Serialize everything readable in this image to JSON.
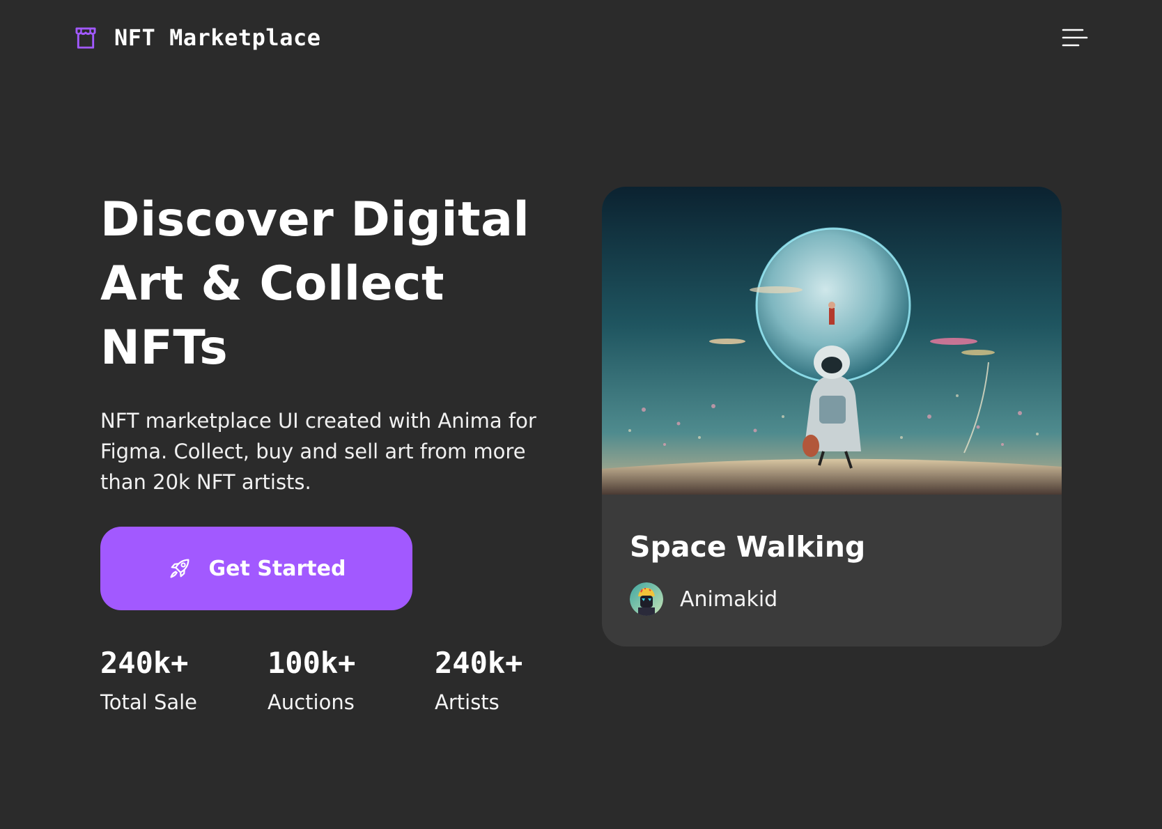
{
  "header": {
    "brand_name": "NFT Marketplace",
    "brand_icon": "storefront-icon",
    "menu_icon": "hamburger-menu-icon"
  },
  "hero": {
    "title": "Discover Digital Art & Collect NFTs",
    "description": "NFT marketplace UI created with Anima for Figma. Collect, buy and sell art from more than 20k NFT artists.",
    "cta_label": "Get Started",
    "cta_icon": "rocket-icon"
  },
  "stats": [
    {
      "value": "240k+",
      "label": "Total Sale"
    },
    {
      "value": "100k+",
      "label": "Auctions"
    },
    {
      "value": "240k+",
      "label": "Artists"
    }
  ],
  "featured": {
    "title": "Space Walking",
    "artist": "Animakid"
  },
  "colors": {
    "background": "#2b2b2b",
    "card": "#3b3b3b",
    "accent": "#a259ff",
    "text": "#ffffff"
  }
}
